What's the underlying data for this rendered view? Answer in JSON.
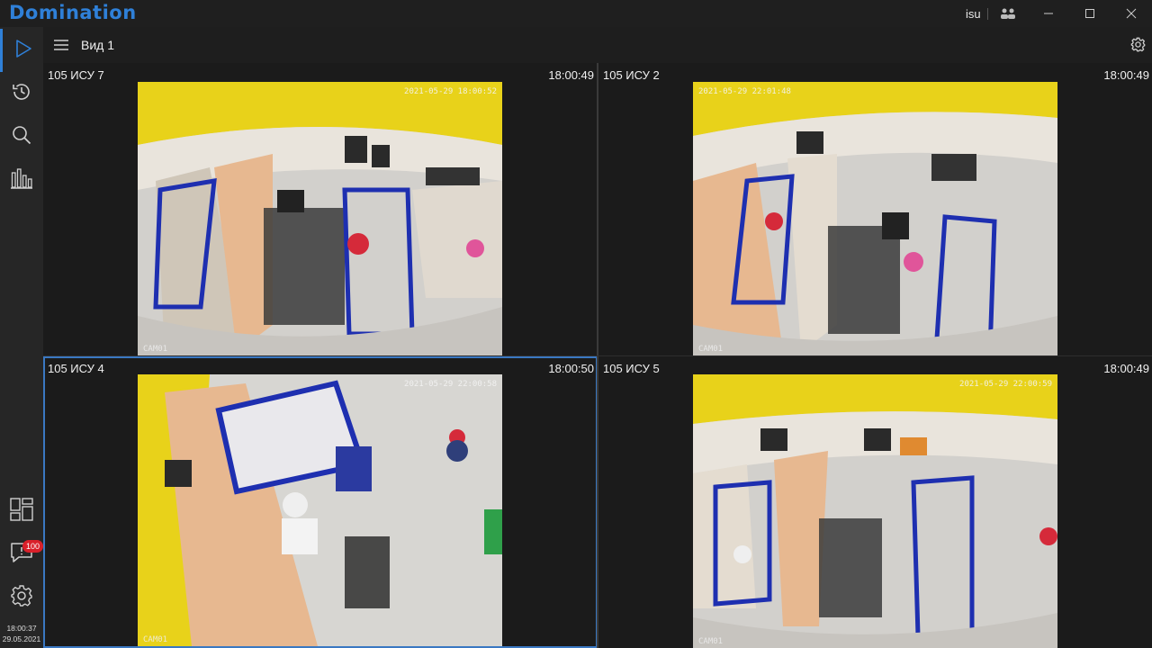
{
  "app": {
    "title": "Domination",
    "user": "isu"
  },
  "header": {
    "view_title": "Вид 1"
  },
  "sidebar": {
    "top_items": [
      {
        "icon": "play-icon",
        "active": true
      },
      {
        "icon": "history-icon"
      },
      {
        "icon": "search-icon"
      },
      {
        "icon": "analytics-icon"
      }
    ],
    "bottom_items": [
      {
        "icon": "layouts-icon"
      },
      {
        "icon": "messages-icon",
        "badge": "100"
      },
      {
        "icon": "settings-icon"
      }
    ],
    "clock_time": "18:00:37",
    "clock_date": "29.05.2021"
  },
  "cameras": [
    {
      "name": "105 ИСУ 7",
      "time": "18:00:49",
      "osd_time": "2021-05-29 18:00:52",
      "label": "CAM01",
      "selected": false
    },
    {
      "name": "105 ИСУ 2",
      "time": "18:00:49",
      "osd_time": "2021-05-29 22:01:48",
      "label": "CAM01",
      "selected": false
    },
    {
      "name": "105 ИСУ 4",
      "time": "18:00:50",
      "osd_time": "2021-05-29 22:00:58",
      "label": "CAM01",
      "selected": true
    },
    {
      "name": "105 ИСУ 5",
      "time": "18:00:49",
      "osd_time": "2021-05-29 22:00:59",
      "label": "CAM01",
      "selected": false
    }
  ],
  "colors": {
    "accent": "#2f80d8",
    "badge": "#d9202a",
    "wall_yellow": "#e8d21a"
  }
}
